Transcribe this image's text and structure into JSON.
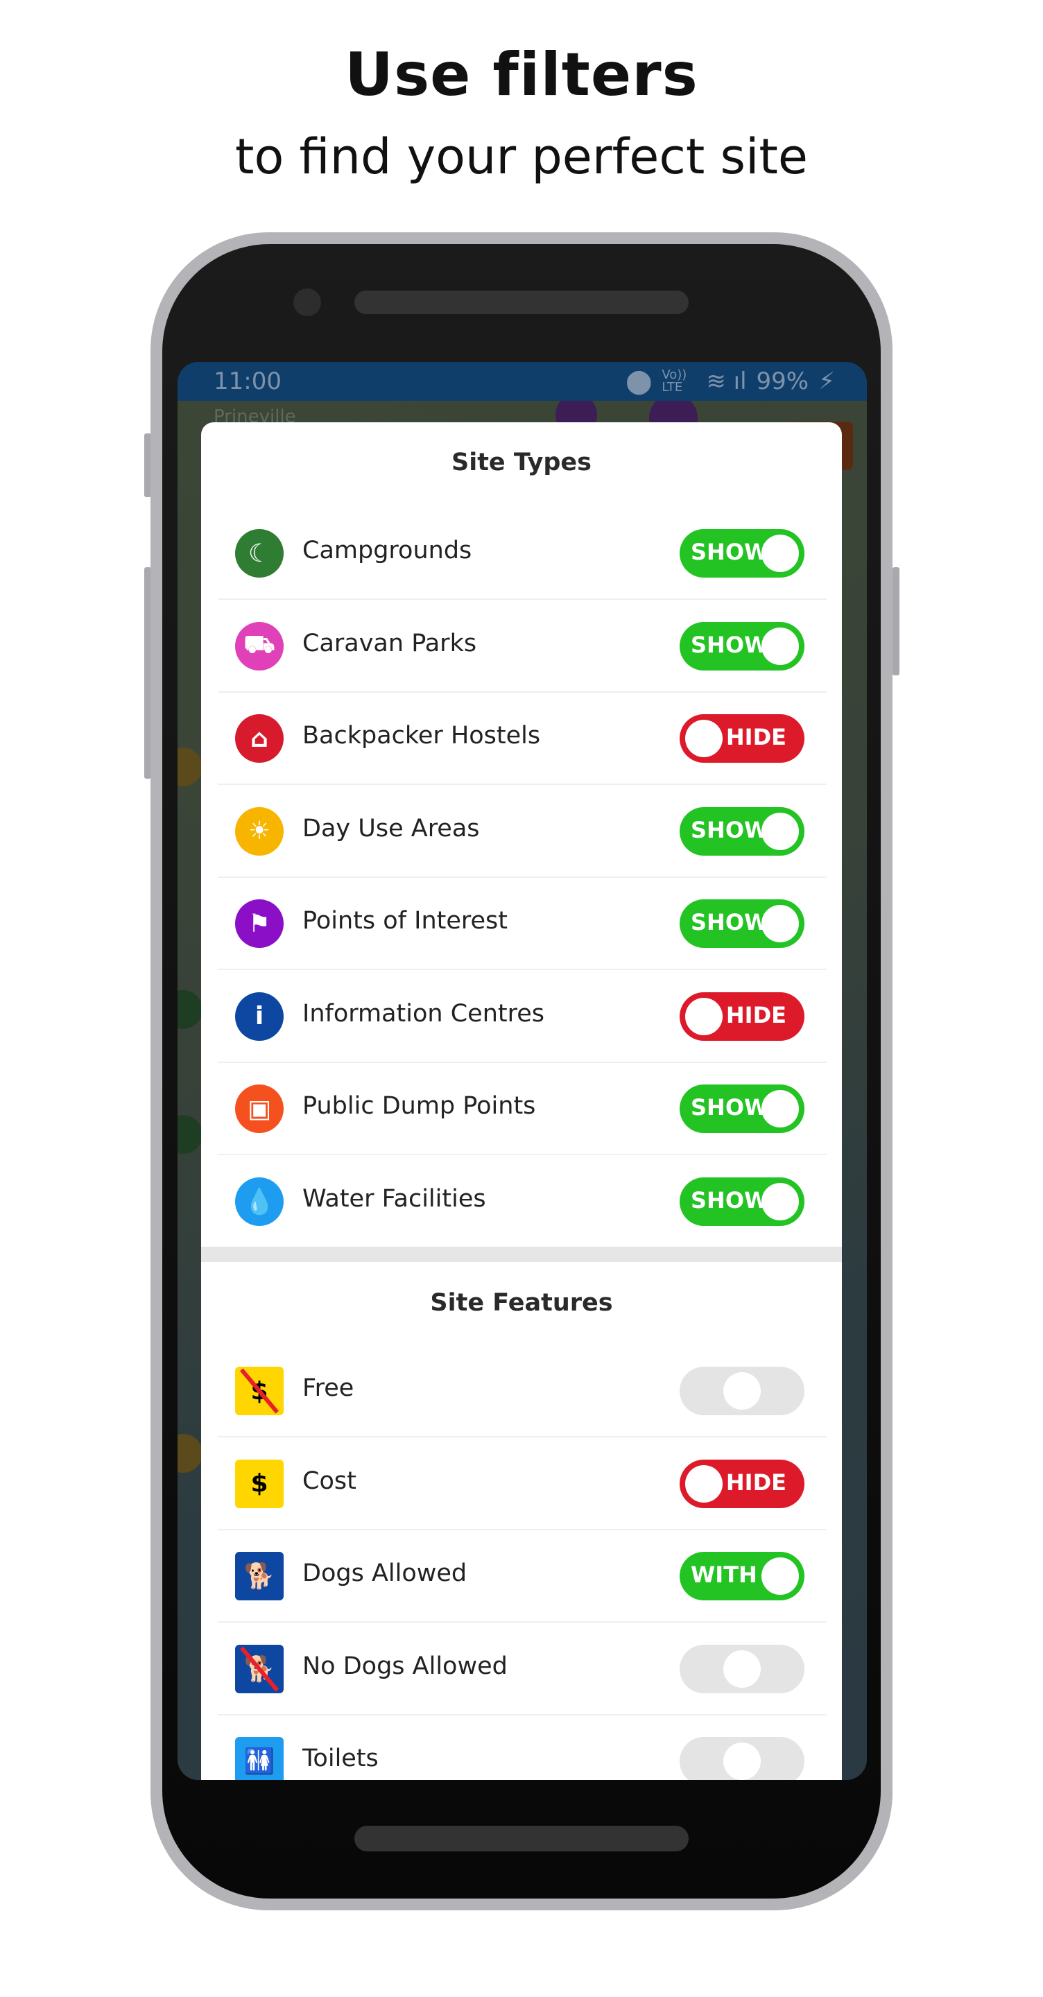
{
  "headline": "Use filters",
  "subheadline": "to find your perfect site",
  "status_bar": {
    "time": "11:00",
    "network": "Vo)) LTE",
    "battery": "99%"
  },
  "map": {
    "place_label": "Prineville"
  },
  "colors": {
    "show": "#22c322",
    "hide": "#dd1a2a",
    "neutral": "#e4e4e4",
    "status_bar": "#0f3e6b"
  },
  "site_types": {
    "title": "Site Types",
    "items": [
      {
        "label": "Campgrounds",
        "icon": "crescent-moon-icon",
        "glyph": "☾",
        "icon_color": "#2e7d32",
        "state": "on",
        "toggle_label": "SHOW"
      },
      {
        "label": "Caravan Parks",
        "icon": "caravan-icon",
        "glyph": "⛟",
        "icon_color": "#e040b8",
        "state": "on",
        "toggle_label": "SHOW"
      },
      {
        "label": "Backpacker Hostels",
        "icon": "hostel-icon",
        "glyph": "⌂",
        "icon_color": "#d81b2c",
        "state": "off",
        "toggle_label": "HIDE"
      },
      {
        "label": "Day Use Areas",
        "icon": "sun-icon",
        "glyph": "☀",
        "icon_color": "#f7b500",
        "state": "on",
        "toggle_label": "SHOW"
      },
      {
        "label": "Points of Interest",
        "icon": "flag-icon",
        "glyph": "⚑",
        "icon_color": "#8a0fc7",
        "state": "on",
        "toggle_label": "SHOW"
      },
      {
        "label": "Information Centres",
        "icon": "info-icon",
        "glyph": "i",
        "icon_color": "#0d47a1",
        "state": "off",
        "toggle_label": "HIDE"
      },
      {
        "label": "Public Dump Points",
        "icon": "dump-point-icon",
        "glyph": "▣",
        "icon_color": "#f4511e",
        "state": "on",
        "toggle_label": "SHOW"
      },
      {
        "label": "Water Facilities",
        "icon": "water-drop-icon",
        "glyph": "💧",
        "icon_color": "#1e9df0",
        "state": "on",
        "toggle_label": "SHOW"
      }
    ]
  },
  "site_features": {
    "title": "Site Features",
    "items": [
      {
        "label": "Free",
        "icon": "no-dollar-icon",
        "glyph": "$",
        "icon_color": "#ffd600",
        "glyph_color": "#000",
        "strike": true,
        "state": "neutral",
        "toggle_label": ""
      },
      {
        "label": "Cost",
        "icon": "dollar-icon",
        "glyph": "$",
        "icon_color": "#ffd600",
        "glyph_color": "#000",
        "strike": false,
        "state": "off",
        "toggle_label": "HIDE"
      },
      {
        "label": "Dogs Allowed",
        "icon": "dog-icon",
        "glyph": "🐕",
        "icon_color": "#0d47a1",
        "glyph_color": "#fff",
        "strike": false,
        "state": "on",
        "toggle_label": "WITH"
      },
      {
        "label": "No Dogs Allowed",
        "icon": "no-dog-icon",
        "glyph": "🐕",
        "icon_color": "#0d47a1",
        "glyph_color": "#fff",
        "strike": true,
        "state": "neutral",
        "toggle_label": ""
      },
      {
        "label": "Toilets",
        "icon": "toilets-icon",
        "glyph": "🚻",
        "icon_color": "#1e9df0",
        "glyph_color": "#fff",
        "strike": false,
        "state": "neutral",
        "toggle_label": ""
      }
    ]
  }
}
